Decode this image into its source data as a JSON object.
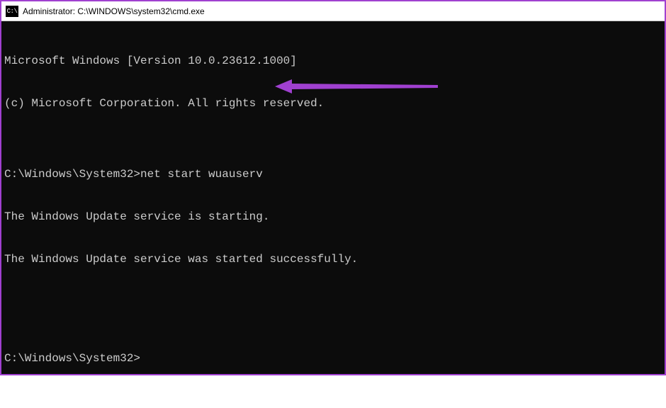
{
  "window": {
    "title": "Administrator: C:\\WINDOWS\\system32\\cmd.exe"
  },
  "terminal": {
    "lines": [
      "Microsoft Windows [Version 10.0.23612.1000]",
      "(c) Microsoft Corporation. All rights reserved.",
      "",
      "C:\\Windows\\System32>net start wuauserv",
      "The Windows Update service is starting.",
      "The Windows Update service was started successfully.",
      "",
      "",
      "C:\\Windows\\System32>"
    ]
  },
  "annotation": {
    "color": "#a040d0"
  }
}
